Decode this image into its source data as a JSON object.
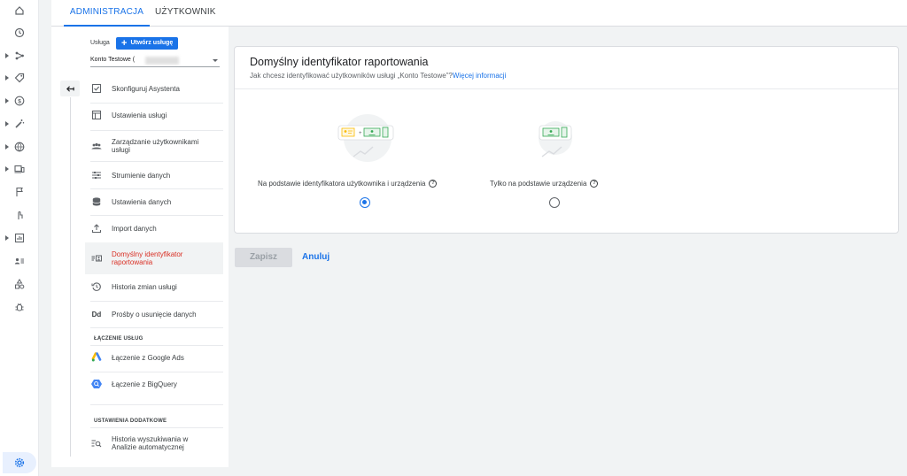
{
  "tabs": [
    {
      "label": "ADMINISTRACJA",
      "active": true
    },
    {
      "label": "UŻYTKOWNIK",
      "active": false
    }
  ],
  "rail": {
    "items": [
      "home-icon",
      "clock-icon",
      "explore-icon",
      "tag-icon",
      "monetization-icon",
      "wand-icon",
      "globe-icon",
      "devices-icon",
      "flag-icon",
      "touch-icon",
      "dashboard-icon",
      "person-list-icon",
      "shapes-icon",
      "bug-icon"
    ],
    "settings": "settings-icon"
  },
  "panel": {
    "service_label": "Usługa",
    "create_button": "Utwórz usługę",
    "account_name": "Konto Testowe (",
    "items": [
      {
        "label": "Skonfiguruj Asystenta",
        "icon": "checkbox-icon"
      },
      {
        "label": "Ustawienia usługi",
        "icon": "property-settings-icon"
      },
      {
        "label": "Zarządzanie użytkownikami usługi",
        "icon": "people-icon"
      },
      {
        "label": "Strumienie danych",
        "icon": "streams-icon"
      },
      {
        "label": "Ustawienia danych",
        "icon": "database-icon"
      },
      {
        "label": "Import danych",
        "icon": "upload-icon"
      },
      {
        "label": "Domyślny identyfikator raportowania",
        "icon": "reporting-id-icon",
        "active": true
      },
      {
        "label": "Historia zmian usługi",
        "icon": "history-icon"
      },
      {
        "label": "Prośby o usunięcie danych",
        "icon": "dd-icon",
        "glyph": "Dd"
      }
    ],
    "linking_section": "ŁĄCZENIE USŁUG",
    "linking_items": [
      {
        "label": "Łączenie z Google Ads",
        "icon": "google-ads-icon"
      },
      {
        "label": "Łączenie z BigQuery",
        "icon": "bigquery-icon"
      }
    ],
    "extra_section": "USTAWIENIA DODATKOWE",
    "extra_items": [
      {
        "label": "Historia wyszukiwania w Analizie automatycznej",
        "icon": "search-history-icon"
      }
    ]
  },
  "card": {
    "title": "Domyślny identyfikator raportowania",
    "subtitle": "Jak chcesz identyfikować użytkowników usługi „Konto Testowe”?",
    "link": "Więcej informacji",
    "options": [
      {
        "label": "Na podstawie identyfikatora użytkownika i urządzenia",
        "help": "?",
        "selected": true
      },
      {
        "label": "Tylko na podstawie urządzenia",
        "help": "?",
        "selected": false
      }
    ]
  },
  "actions": {
    "save": "Zapisz",
    "cancel": "Anuluj"
  },
  "colors": {
    "accent": "#1a73e8",
    "active_text": "#d93025"
  }
}
